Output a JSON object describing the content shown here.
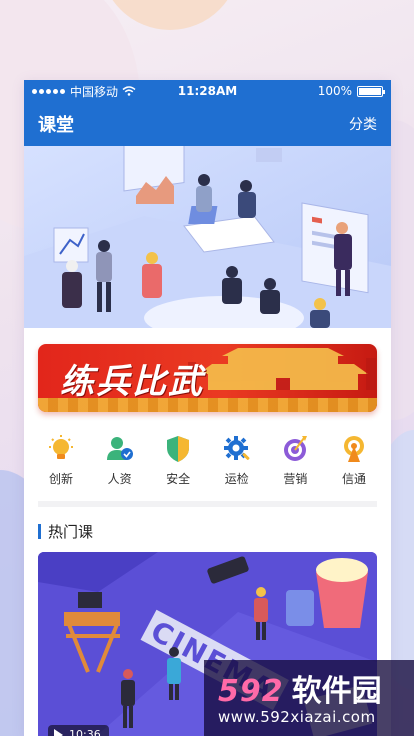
{
  "status_bar": {
    "carrier": "中国移动",
    "time": "11:28AM",
    "battery": "100%"
  },
  "nav": {
    "title": "课堂",
    "category": "分类"
  },
  "banner": {
    "text": "练兵比武"
  },
  "categories": [
    {
      "label": "创新",
      "icon": "lightbulb-icon",
      "color": "#f5b731"
    },
    {
      "label": "人资",
      "icon": "person-icon",
      "color": "#3bb37b"
    },
    {
      "label": "安全",
      "icon": "shield-icon",
      "color": "#3bb37b"
    },
    {
      "label": "运检",
      "icon": "gear-icon",
      "color": "#1f6fd1"
    },
    {
      "label": "营销",
      "icon": "target-icon",
      "color": "#8c5bd8"
    },
    {
      "label": "信通",
      "icon": "signal-icon",
      "color": "#f0a020"
    }
  ],
  "hot": {
    "title": "热门课",
    "course": {
      "duration": "10:36",
      "cover_text": "CINEMA"
    }
  },
  "watermark": {
    "number": "592",
    "name": "软件园",
    "url": "www.592xiazai.com"
  },
  "colors": {
    "primary": "#1f6fd1",
    "banner_red": "#e2261b",
    "course_purple": "#5b4fd6"
  }
}
